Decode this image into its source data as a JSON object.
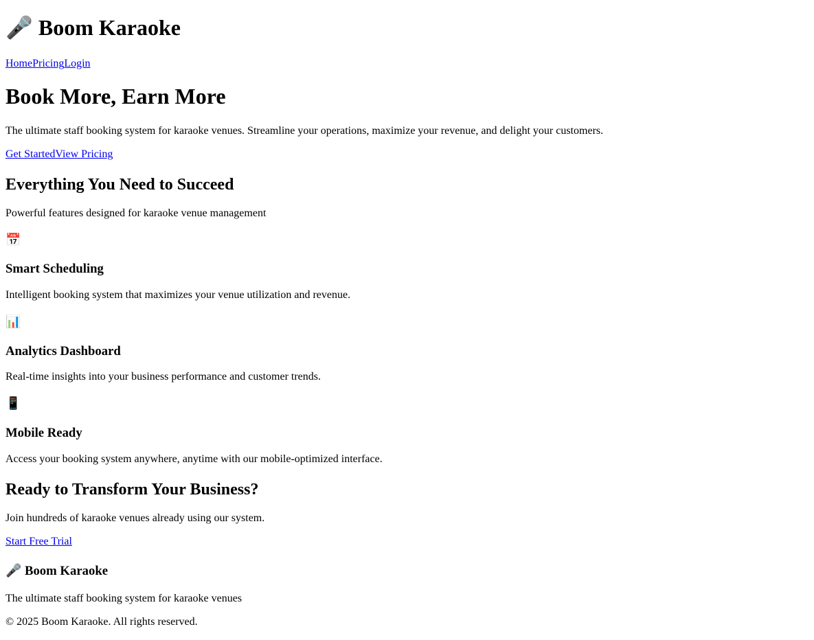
{
  "header": {
    "brand_icon": "🎤",
    "brand_icon_name": "microphone-icon",
    "brand_name": "Boom Karaoke",
    "nav": [
      "Home",
      "Pricing",
      "Login"
    ]
  },
  "hero": {
    "title": "Book More, Earn More",
    "subtitle": "The ultimate staff booking system for karaoke venues. Streamline your operations, maximize your revenue, and delight your customers.",
    "buttons": [
      "Get Started",
      "View Pricing"
    ]
  },
  "features": {
    "title": "Everything You Need to Succeed",
    "subtitle": "Powerful features designed for karaoke venue management",
    "items": [
      {
        "icon": "📅",
        "icon_name": "calendar-icon",
        "title": "Smart Scheduling",
        "desc": "Intelligent booking system that maximizes your venue utilization and revenue."
      },
      {
        "icon": "📊",
        "icon_name": "bar-chart-icon",
        "title": "Analytics Dashboard",
        "desc": "Real-time insights into your business performance and customer trends."
      },
      {
        "icon": "📱",
        "icon_name": "mobile-phone-icon",
        "title": "Mobile Ready",
        "desc": "Access your booking system anywhere, anytime with our mobile-optimized interface."
      }
    ]
  },
  "cta": {
    "title": "Ready to Transform Your Business?",
    "subtitle": "Join hundreds of karaoke venues already using our system.",
    "button": "Start Free Trial"
  },
  "footer": {
    "brand_icon": "🎤",
    "brand_name": "Boom Karaoke",
    "tagline": "The ultimate staff booking system for karaoke venues",
    "copyright": "© 2025 Boom Karaoke. All rights reserved."
  },
  "colors": {
    "link": "#0000ee",
    "text": "#000000",
    "background": "#ffffff"
  }
}
